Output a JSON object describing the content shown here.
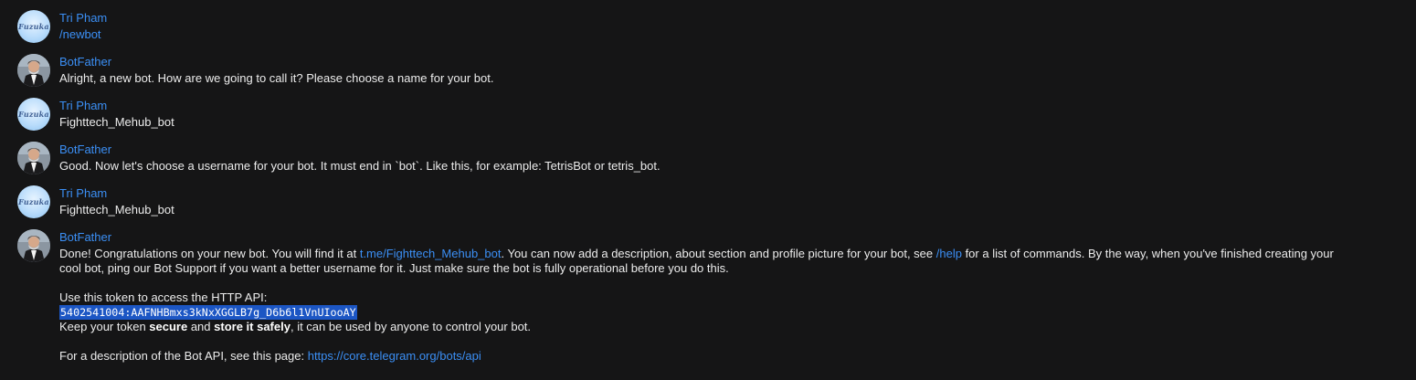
{
  "messages": [
    {
      "sender": "Tri Pham",
      "avatar_text": "Fuzuka",
      "text": "/newbot"
    },
    {
      "sender": "BotFather",
      "text": "Alright, a new bot. How are we going to call it? Please choose a name for your bot."
    },
    {
      "sender": "Tri Pham",
      "avatar_text": "Fuzuka",
      "text": "Fighttech_Mehub_bot"
    },
    {
      "sender": "BotFather",
      "text": "Good. Now let's choose a username for your bot. It must end in `bot`. Like this, for example: TetrisBot or tetris_bot."
    },
    {
      "sender": "Tri Pham",
      "avatar_text": "Fuzuka",
      "text": "Fighttech_Mehub_bot"
    },
    {
      "sender": "BotFather",
      "done": {
        "p1_a": "Done! Congratulations on your new bot. You will find it at ",
        "p1_link": "t.me/Fighttech_Mehub_bot",
        "p1_b": ". You can now add a description, about section and profile picture for your bot, see ",
        "p1_help": "/help",
        "p1_c": " for a list of commands. By the way, when you've finished creating your",
        "p2": "cool bot, ping our Bot Support if you want a better username for it. Just make sure the bot is fully operational before you do this.",
        "token_label": "Use this token to access the HTTP API:",
        "token": "5402541004:AAFNHBmxs3kNxXGGLB7g_D6b6l1VnUIooAY",
        "keep_a": "Keep your token ",
        "keep_secure": "secure",
        "keep_b": " and ",
        "keep_store": "store it safely",
        "keep_c": ", it can be used by anyone to control your bot.",
        "desc_a": "For a description of the Bot API, see this page: ",
        "desc_link": "https://core.telegram.org/bots/api"
      }
    }
  ],
  "colors": {
    "background": "#151516",
    "sender": "#3b8ff5",
    "link": "#3b8ff5",
    "selection": "#1c56c4"
  }
}
